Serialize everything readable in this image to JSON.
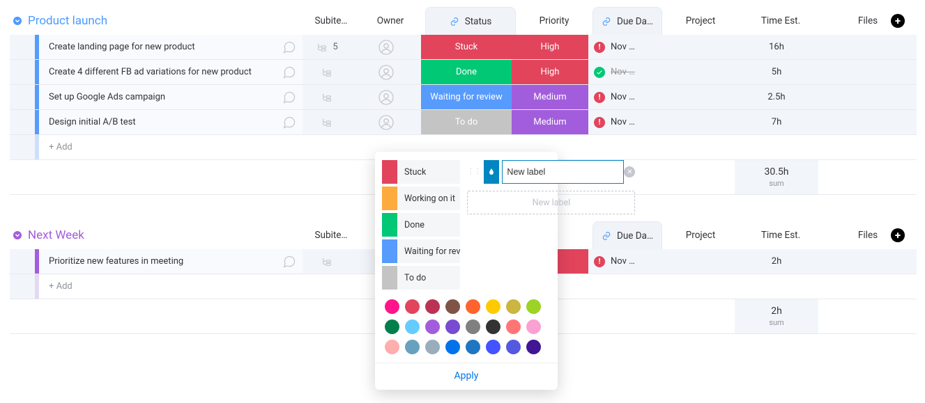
{
  "columns": {
    "subitems": "Subite…",
    "owner": "Owner",
    "status": "Status",
    "priority": "Priority",
    "due_date": "Due Da…",
    "project": "Project",
    "time_est": "Time Est.",
    "files": "Files"
  },
  "add_label": "+ Add",
  "sum_label": "sum",
  "groups": [
    {
      "name": "Product launch",
      "color_class": "title-blue",
      "bar_class": "bar-blue",
      "bar_light_class": "bar-blue-light",
      "sum": "30.5h",
      "rows": [
        {
          "name": "Create landing page for new product",
          "subitems": "5",
          "status": "Stuck",
          "status_bg": "bg-stuck",
          "priority": "High",
          "priority_bg": "bg-high",
          "due": "Nov …",
          "due_state": "alert",
          "time": "16h"
        },
        {
          "name": "Create 4 different FB ad variations for new product",
          "subitems": "",
          "status": "Done",
          "status_bg": "bg-done",
          "priority": "High",
          "priority_bg": "bg-high",
          "due": "Nov …",
          "due_state": "done",
          "time": "5h"
        },
        {
          "name": "Set up Google Ads campaign",
          "subitems": "",
          "status": "Waiting for review",
          "status_bg": "bg-wait",
          "priority": "Medium",
          "priority_bg": "bg-medium",
          "due": "Nov …",
          "due_state": "alert",
          "time": "2.5h"
        },
        {
          "name": "Design initial A/B test",
          "subitems": "",
          "status": "To do",
          "status_bg": "bg-todo",
          "priority": "Medium",
          "priority_bg": "bg-medium",
          "due": "Nov …",
          "due_state": "alert",
          "time": "7h"
        }
      ]
    },
    {
      "name": "Next Week",
      "color_class": "title-purple",
      "bar_class": "bar-purple",
      "bar_light_class": "bar-purple-light",
      "sum": "2h",
      "rows": [
        {
          "name": "Prioritize new features in meeting",
          "subitems": "",
          "status": "",
          "status_bg": "",
          "priority": "",
          "priority_bg": "bg-high",
          "due": "Nov …",
          "due_state": "alert",
          "time": "2h"
        }
      ]
    }
  ],
  "popup": {
    "labels": [
      {
        "text": "Stuck",
        "bg": "#e2445c"
      },
      {
        "text": "Working on it",
        "bg": "#fdab3d"
      },
      {
        "text": "Done",
        "bg": "#00c875"
      },
      {
        "text": "Waiting for rev",
        "bg": "#579bfc"
      },
      {
        "text": "To do",
        "bg": "#c4c4c4"
      }
    ],
    "new_label_value": "New label",
    "placeholder": "New label",
    "apply": "Apply",
    "swatches": [
      "#ff158a",
      "#e2445c",
      "#bb3354",
      "#7f5347",
      "#ff642e",
      "#ffcb00",
      "#cab641",
      "#9cd326",
      "#037f4c",
      "#66ccff",
      "#a25ddc",
      "#784bd1",
      "#808080",
      "#333333",
      "#ff7575",
      "#faa1d1",
      "#ffadad",
      "#68a1bd",
      "#9aadbd",
      "#0073ea",
      "#1f76c2",
      "#4353ff",
      "#5559df",
      "#401694"
    ]
  }
}
